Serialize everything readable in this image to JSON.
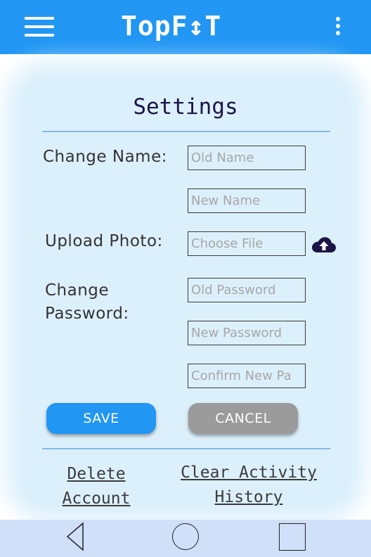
{
  "app": {
    "title": "TopF↕T"
  },
  "settings": {
    "title": "Settings",
    "change_name_label": "Change Name:",
    "upload_photo_label": "Upload Photo:",
    "change_password_label_line1": "Change",
    "change_password_label_line2": "Password:",
    "old_name_placeholder": "Old Name",
    "new_name_placeholder": "New Name",
    "choose_file_placeholder": "Choose File",
    "old_password_placeholder": "Old Password",
    "new_password_placeholder": "New Password",
    "confirm_password_placeholder": "Confirm New Pa",
    "save_label": "SAVE",
    "cancel_label": "CANCEL",
    "delete_account_line1": "Delete",
    "delete_account_line2": "Account",
    "clear_history_line1": "Clear Activity",
    "clear_history_line2": "History"
  },
  "icons": {
    "menu": "hamburger-menu-icon",
    "overflow": "more-vertical-icon",
    "upload": "cloud-upload-icon",
    "back": "back-triangle-icon",
    "home": "home-circle-icon",
    "recent": "recent-apps-square-icon"
  },
  "colors": {
    "primary": "#2196f3",
    "card_background": "#dcf0fc",
    "title_text": "#1b1546",
    "cancel_button": "#9b9b9b",
    "nav_bar": "#cfe0f8"
  }
}
